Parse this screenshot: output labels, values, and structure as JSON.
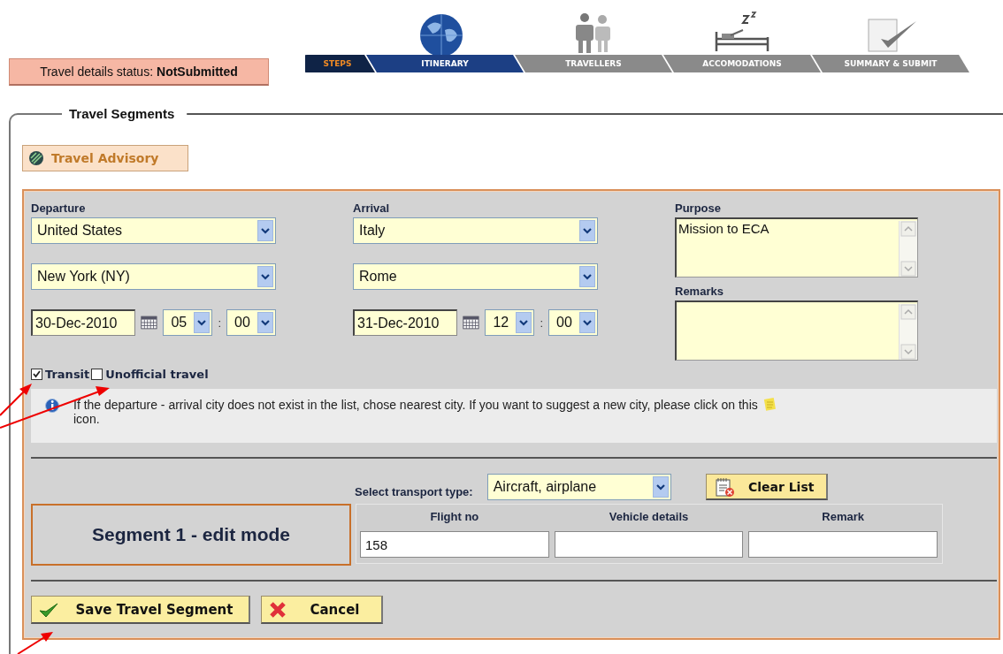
{
  "status": {
    "label": "Travel details status:",
    "value": "NotSubmitted"
  },
  "steps": {
    "label": "STEPS",
    "items": [
      {
        "label": "ITINERARY",
        "kind": "globe",
        "selected": true
      },
      {
        "label": "TRAVELLERS",
        "kind": "people",
        "selected": false
      },
      {
        "label": "ACCOMODATIONS",
        "kind": "bed",
        "selected": false
      },
      {
        "label": "SUMMARY & SUBMIT",
        "kind": "check",
        "selected": false
      }
    ]
  },
  "segments": {
    "legend": "Travel Segments",
    "advisory_button": "Travel Advisory",
    "departure": {
      "label": "Departure",
      "country": "United States",
      "city": "New York (NY)",
      "date": "30-Dec-2010",
      "hour": "05",
      "time_separator": ":",
      "minute": "00"
    },
    "arrival": {
      "label": "Arrival",
      "country": "Italy",
      "city": "Rome",
      "date": "31-Dec-2010",
      "hour": "12",
      "time_separator": ":",
      "minute": "00"
    },
    "purpose": {
      "label": "Purpose",
      "value": "Mission to ECA"
    },
    "remarks": {
      "label": "Remarks"
    },
    "options": [
      {
        "label": "Transit",
        "checked": true
      },
      {
        "label": "Unofficial travel",
        "checked": false
      }
    ],
    "info": {
      "text": "If the departure - arrival city does not exist in the list, chose nearest city. If you want to suggest a new city, please click on this",
      "tail": "icon."
    },
    "transport": {
      "label": "Select transport type:",
      "value": "Aircraft, airplane",
      "clear_button": "Clear List"
    },
    "segment_title": "Segment 1 - edit mode",
    "columns": [
      {
        "heading": "Flight no",
        "value": "158"
      },
      {
        "heading": "Vehicle details"
      },
      {
        "heading": "Remark"
      }
    ],
    "actions": [
      {
        "label": "Save Travel Segment",
        "kind": "save"
      },
      {
        "label": "Cancel",
        "kind": "cancel"
      }
    ]
  }
}
